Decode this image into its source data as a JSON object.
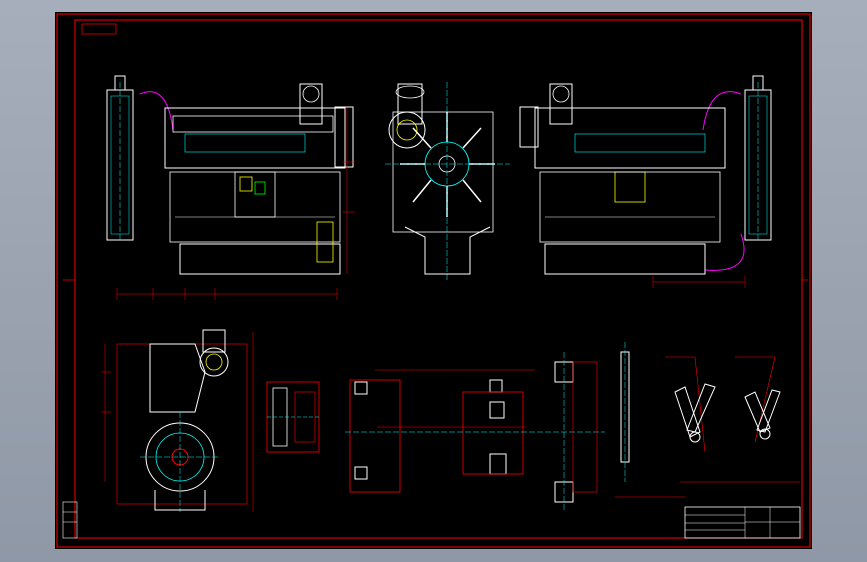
{
  "drawing": {
    "stamp_text": "",
    "title_block": {
      "label_1": "",
      "label_2": ""
    }
  },
  "colors": {
    "frame": "#ff0000",
    "outline": "#ffffff",
    "centerline": "#00ffff",
    "detail_yellow": "#ffff00",
    "detail_green": "#00ff00",
    "detail_magenta": "#ff00ff",
    "background": "#000000"
  }
}
